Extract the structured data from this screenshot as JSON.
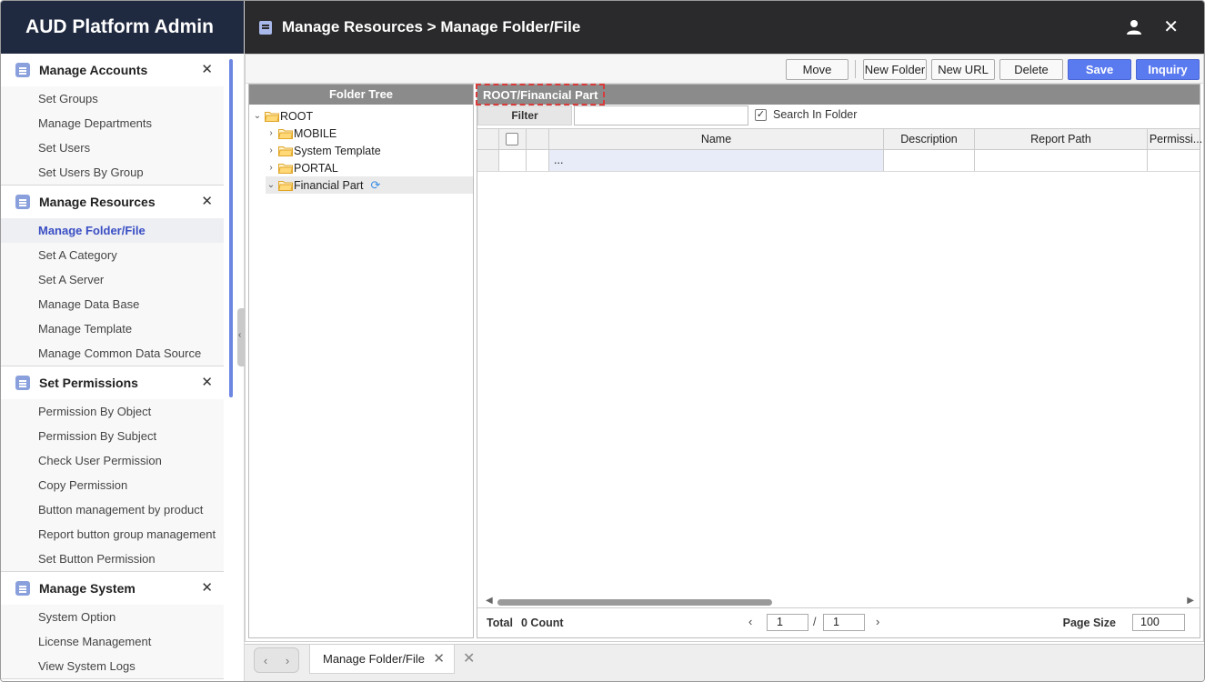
{
  "brand": "AUD Platform Admin",
  "header": {
    "title": "Manage Resources > Manage Folder/File"
  },
  "sidebar": {
    "groups": [
      {
        "title": "Manage Accounts",
        "items": [
          "Set Groups",
          "Manage Departments",
          "Set Users",
          "Set Users By Group"
        ]
      },
      {
        "title": "Manage Resources",
        "items": [
          "Manage Folder/File",
          "Set A Category",
          "Set A Server",
          "Manage Data Base",
          "Manage Template",
          "Manage Common Data Source"
        ]
      },
      {
        "title": "Set Permissions",
        "items": [
          "Permission By Object",
          "Permission By Subject",
          "Check User Permission",
          "Copy Permission",
          "Button management by product",
          "Report button group management",
          "Set Button Permission"
        ]
      },
      {
        "title": "Manage System",
        "items": [
          "System Option",
          "License Management",
          "View System Logs"
        ]
      }
    ],
    "active_item": "Manage Folder/File"
  },
  "toolbar": {
    "move": "Move",
    "new_folder": "New Folder",
    "new_url": "New URL",
    "delete": "Delete",
    "save": "Save",
    "inquiry": "Inquiry"
  },
  "tree": {
    "title": "Folder Tree",
    "root": "ROOT",
    "children": [
      "MOBILE",
      "System Template",
      "PORTAL",
      "Financial Part"
    ],
    "selected": "Financial Part"
  },
  "list": {
    "path": "ROOT/Financial Part",
    "filter_label": "Filter",
    "filter_value": "",
    "search_in_folder": "Search In Folder",
    "search_in_folder_checked": true,
    "columns": [
      "Name",
      "Description",
      "Report Path",
      "Permissi..."
    ],
    "rows": [
      {
        "name": "...",
        "description": "",
        "report_path": "",
        "permission": ""
      }
    ]
  },
  "footer": {
    "total_label": "Total",
    "count": "0 Count",
    "page": "1",
    "page_total": "1",
    "page_size_label": "Page Size",
    "page_size": "100"
  },
  "tabs": {
    "items": [
      "Manage Folder/File"
    ]
  },
  "icons": {
    "user": "user-icon",
    "close": "close-icon",
    "folder": "folder-icon",
    "refresh": "refresh-icon"
  },
  "colors": {
    "brand_bg": "#1f2940",
    "header_bg": "#2a2a2c",
    "accent": "#5a7af0",
    "active_text": "#3a4ec4",
    "highlight_dash": "#d93a3a"
  }
}
